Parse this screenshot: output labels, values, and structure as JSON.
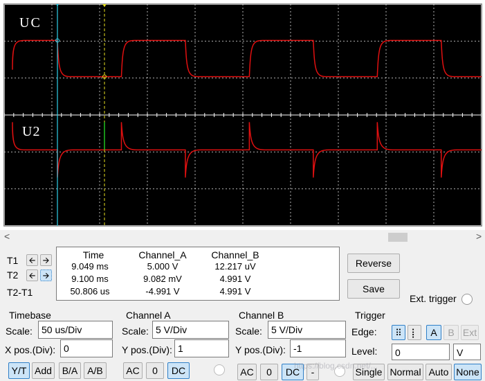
{
  "scope": {
    "label_top": "UC",
    "label_bottom": "U2",
    "colors": {
      "background": "#000000",
      "grid": "#ffffff",
      "trace": "#e01010",
      "cursor1": "#30d0e8",
      "cursor2": "#e8e020"
    },
    "cursor_markers": {
      "t1": "1",
      "t2": "2"
    }
  },
  "readout": {
    "rows": [
      "T1",
      "T2",
      "T2-T1"
    ],
    "headers": [
      "Time",
      "Channel_A",
      "Channel_B"
    ],
    "values": [
      [
        "9.049 ms",
        "5.000 V",
        "12.217 uV"
      ],
      [
        "9.100 ms",
        "9.082 mV",
        "4.991 V"
      ],
      [
        "50.806 us",
        "-4.991 V",
        "4.991 V"
      ]
    ]
  },
  "buttons": {
    "reverse": "Reverse",
    "save": "Save",
    "ext_trigger": "Ext. trigger"
  },
  "timebase": {
    "title": "Timebase",
    "scale_label": "Scale:",
    "scale_value": "50 us/Div",
    "xpos_label": "X pos.(Div):",
    "xpos_value": "0",
    "modes": [
      "Y/T",
      "Add",
      "B/A",
      "A/B"
    ]
  },
  "channel_a": {
    "title": "Channel A",
    "scale_label": "Scale:",
    "scale_value": "5  V/Div",
    "ypos_label": "Y pos.(Div):",
    "ypos_value": "1",
    "coupling": [
      "AC",
      "0",
      "DC"
    ]
  },
  "channel_b": {
    "title": "Channel B",
    "scale_label": "Scale:",
    "scale_value": "5  V/Div",
    "ypos_label": "Y pos.(Div):",
    "ypos_value": "-1",
    "coupling": [
      "AC",
      "0",
      "DC",
      "-"
    ]
  },
  "trigger": {
    "title": "Trigger",
    "edge_label": "Edge:",
    "sources": [
      "A",
      "B",
      "Ext"
    ],
    "level_label": "Level:",
    "level_value": "0",
    "level_unit": "V",
    "modes": [
      "Single",
      "Normal",
      "Auto",
      "None"
    ]
  },
  "scroll": {
    "left": "<",
    "right": ">"
  },
  "watermark": "https://blog.csdn.net/..."
}
